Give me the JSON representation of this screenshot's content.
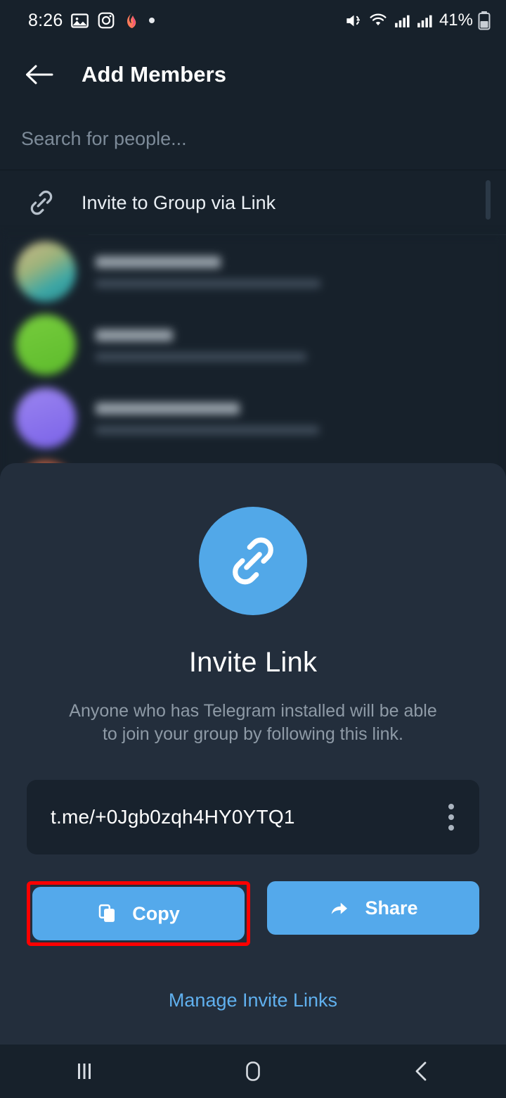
{
  "status_bar": {
    "time": "8:26",
    "battery_percent": "41%",
    "left_icons": [
      "photos-icon",
      "instagram-icon",
      "app-icon",
      "dot-icon"
    ],
    "right_icons": [
      "mute-icon",
      "wifi-icon",
      "signal-sim1-icon",
      "signal-sim2-icon",
      "battery-icon"
    ]
  },
  "app_bar": {
    "back_icon": "back-arrow-icon",
    "title": "Add Members"
  },
  "search": {
    "placeholder": "Search for people...",
    "value": ""
  },
  "invite_row": {
    "icon": "link-icon",
    "label": "Invite to Group via Link"
  },
  "contact_list": {
    "blurred": true,
    "rows": [
      {
        "avatar_color": "#8fae7a",
        "name_hidden": true,
        "subtitle_hidden": true
      },
      {
        "avatar_color": "#6dc233",
        "name_hidden": true,
        "subtitle_hidden": true
      },
      {
        "avatar_color": "#8a72ec",
        "name_hidden": true,
        "subtitle_hidden": true
      },
      {
        "avatar_color": "#c05a3c",
        "name_hidden": true,
        "subtitle_hidden": true
      }
    ]
  },
  "sheet": {
    "icon": "link-icon",
    "icon_bg": "#52a8e8",
    "title": "Invite Link",
    "description": "Anyone who has Telegram installed will be able to join your group by following this link.",
    "link": "t.me/+0Jgb0zqh4HY0YTQ1",
    "menu_icon": "more-vertical-icon",
    "copy_button": {
      "label": "Copy",
      "icon": "copy-icon",
      "highlighted": true,
      "highlight_color": "#ff0000"
    },
    "share_button": {
      "label": "Share",
      "icon": "share-arrow-icon"
    },
    "manage_link": "Manage Invite Links",
    "accent_color": "#54a9eb",
    "link_color": "#60b0ee"
  },
  "nav_bar": {
    "recents_icon": "recents-icon",
    "home_icon": "home-icon",
    "back_icon": "nav-back-icon"
  }
}
